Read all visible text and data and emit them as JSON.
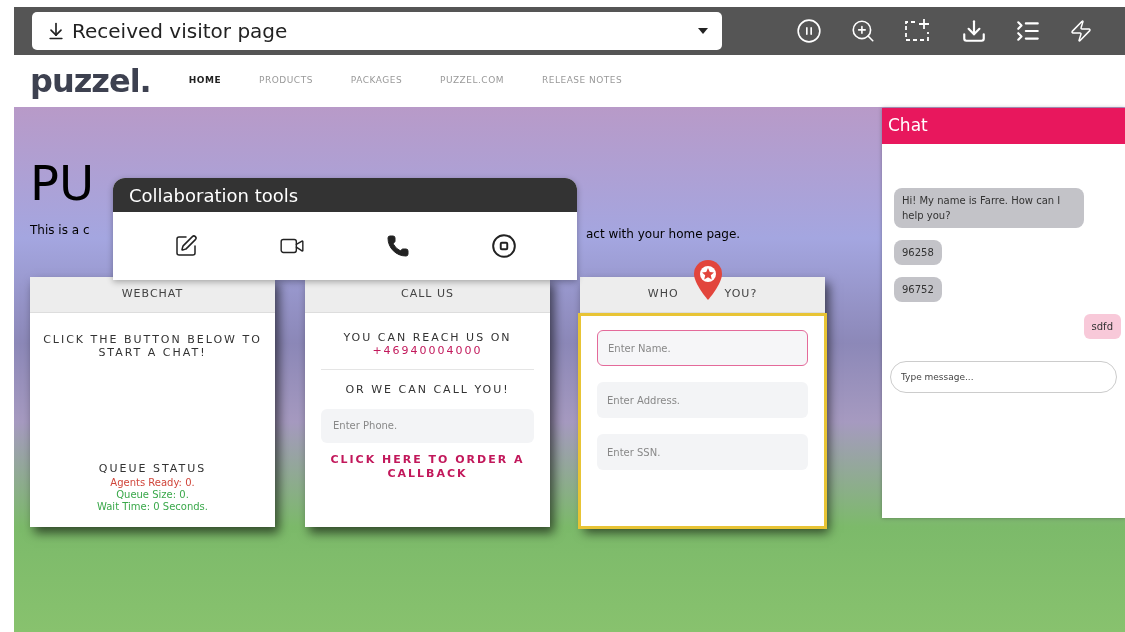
{
  "toolbar": {
    "page_select": "Received visitor page"
  },
  "site": {
    "logo": "puzzel.",
    "nav": [
      {
        "label": "HOME",
        "selected": true
      },
      {
        "label": "PRODUCTS",
        "selected": false
      },
      {
        "label": "PACKAGES",
        "selected": false
      },
      {
        "label": "PUZZEL.COM",
        "selected": false
      },
      {
        "label": "RELEASE NOTES",
        "selected": false
      }
    ],
    "hero": {
      "heading": "PU",
      "text_start": "This is a c",
      "text_end": "act with your home page."
    },
    "cards": [
      {
        "title": "WEBCHAT",
        "highlighted": false,
        "prompt": "CLICK THE BUTTON BELOW TO START A CHAT!",
        "queue_title": "QUEUE STATUS",
        "queue": [
          {
            "text": "Agents Ready: 0.",
            "color": "#d0453a"
          },
          {
            "text": "Queue Size: 0.",
            "color": "#3aa84a"
          },
          {
            "text": "Wait Time: 0 Seconds.",
            "color": "#3aa84a"
          }
        ]
      },
      {
        "title": "CALL US",
        "highlighted": false,
        "reach": "YOU CAN REACH US ON",
        "phone": "+46940004000",
        "call_you": "OR WE CAN CALL YOU!",
        "phone_placeholder": "Enter Phone.",
        "callback": "CLICK HERE TO ORDER A CALLBACK"
      },
      {
        "title": "WHO",
        "title_end": "YOU?",
        "highlighted": true,
        "fields": [
          {
            "placeholder": "Enter Name.",
            "focused": true
          },
          {
            "placeholder": "Enter Address.",
            "focused": false
          },
          {
            "placeholder": "Enter SSN.",
            "focused": false
          }
        ]
      }
    ]
  },
  "collaboration": {
    "title": "Collaboration tools"
  },
  "chat": {
    "title": "Chat",
    "messages": [
      {
        "kind": "agent",
        "text": "Hi! My name is Farre. How can I help you?"
      },
      {
        "kind": "agent",
        "text": "96258"
      },
      {
        "kind": "agent",
        "text": "96752"
      },
      {
        "kind": "visitor",
        "text": "sdfd"
      }
    ],
    "placeholder": "Type message..."
  }
}
